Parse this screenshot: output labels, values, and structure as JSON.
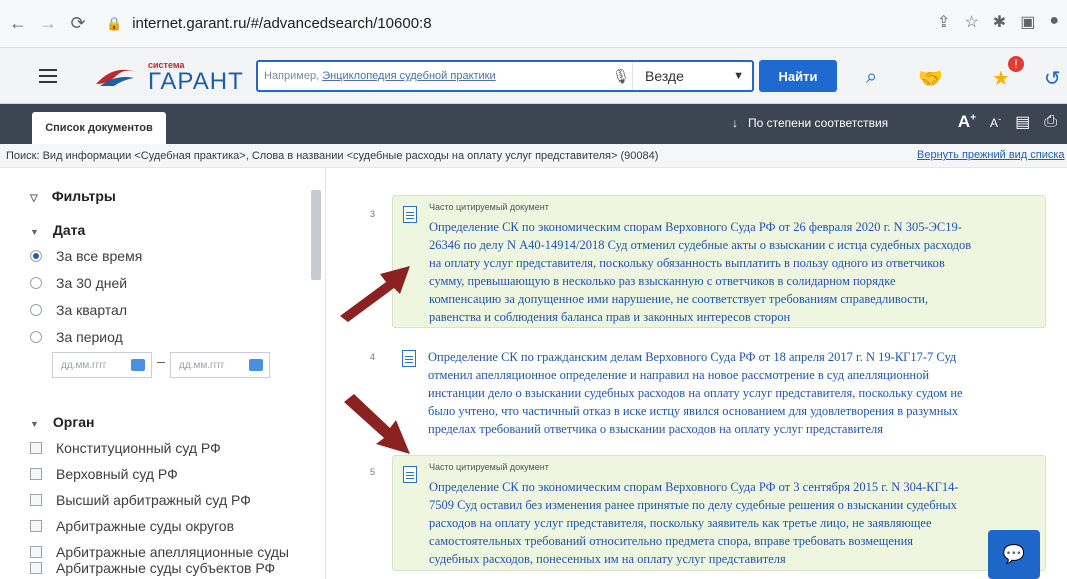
{
  "browser": {
    "url": "internet.garant.ru/#/advancedsearch/10600:8"
  },
  "header": {
    "logo_small": "система",
    "logo_brand": "ГАРАНТ",
    "search_prefix": "Например, ",
    "search_example": "Энциклопедия судебной практики",
    "scope": "Везде",
    "find_button": "Найти"
  },
  "toolbar": {
    "tab": "Список документов",
    "sort": "По степени соответствия",
    "font_up": "A",
    "font_up_sup": "+",
    "font_down": "A",
    "font_down_sup": "-"
  },
  "query": {
    "text": "Поиск: Вид информации <Судебная практика>, Слова в названии <судебные расходы на оплату услуг представителя> (90084)",
    "back_link": "Вернуть прежний вид списка"
  },
  "filters": {
    "title": "Фильтры",
    "date_title": "Дата",
    "date_options": [
      "За все время",
      "За 30 дней",
      "За квартал",
      "За период"
    ],
    "date_placeholder_from": "дд.мм.гггг",
    "date_placeholder_to": "дд.мм.гггг",
    "organ_title": "Орган",
    "organs": [
      "Конституционный суд РФ",
      "Верховный суд РФ",
      "Высший арбитражный суд РФ",
      "Арбитражные суды округов",
      "Арбитражные апелляционные суды",
      "Арбитражные суды субъектов РФ"
    ]
  },
  "results": [
    {
      "num": "3",
      "label": "Часто цитируемый документ",
      "lines": [
        "Определение СК по экономическим спорам Верховного Суда РФ от 26 февраля 2020 г. N 305-ЭС19-",
        "26346 по делу N А40-14914/2018 Суд отменил судебные акты о взыскании с истца судебных расходов",
        "на оплату услуг представителя, поскольку обязанность выплатить в пользу одного из ответчиков",
        "сумму, превышающую в несколько раз взысканную с ответчиков в солидарном порядке",
        "компенсацию за допущенное ими нарушение, не соответствует требованиям справедливости,",
        "равенства и соблюдения баланса прав и законных интересов сторон"
      ]
    },
    {
      "num": "4",
      "label": "",
      "lines": [
        "Определение СК по гражданским делам Верховного Суда РФ от 18 апреля 2017 г. N 19-КГ17-7 Суд",
        "отменил апелляционное определение и направил на новое рассмотрение в суд апелляционной",
        "инстанции дело о взыскании судебных расходов на оплату услуг представителя, поскольку судом не",
        "было учтено, что частичный отказ в иске истцу явился основанием для удовлетворения в разумных",
        "пределах требований ответчика о взыскании расходов на оплату услуг представителя"
      ]
    },
    {
      "num": "5",
      "label": "Часто цитируемый документ",
      "lines": [
        "Определение СК по экономическим спорам Верховного Суда РФ от 3 сентября 2015 г. N 304-КГ14-",
        "7509 Суд оставил без изменения ранее принятые по делу судебные решения о взыскании судебных",
        "расходов на оплату услуг представителя, поскольку заявитель как третье лицо, не заявляющее",
        "самостоятельных требований относительно предмета спора, вправе требовать возмещения",
        "судебных расходов, понесенных им на оплату услуг представителя"
      ]
    }
  ],
  "colors": {
    "accent": "#1f6ad0",
    "toolbar": "#3c4652",
    "highlight": "#eef6df",
    "arrow": "#8b2222"
  }
}
